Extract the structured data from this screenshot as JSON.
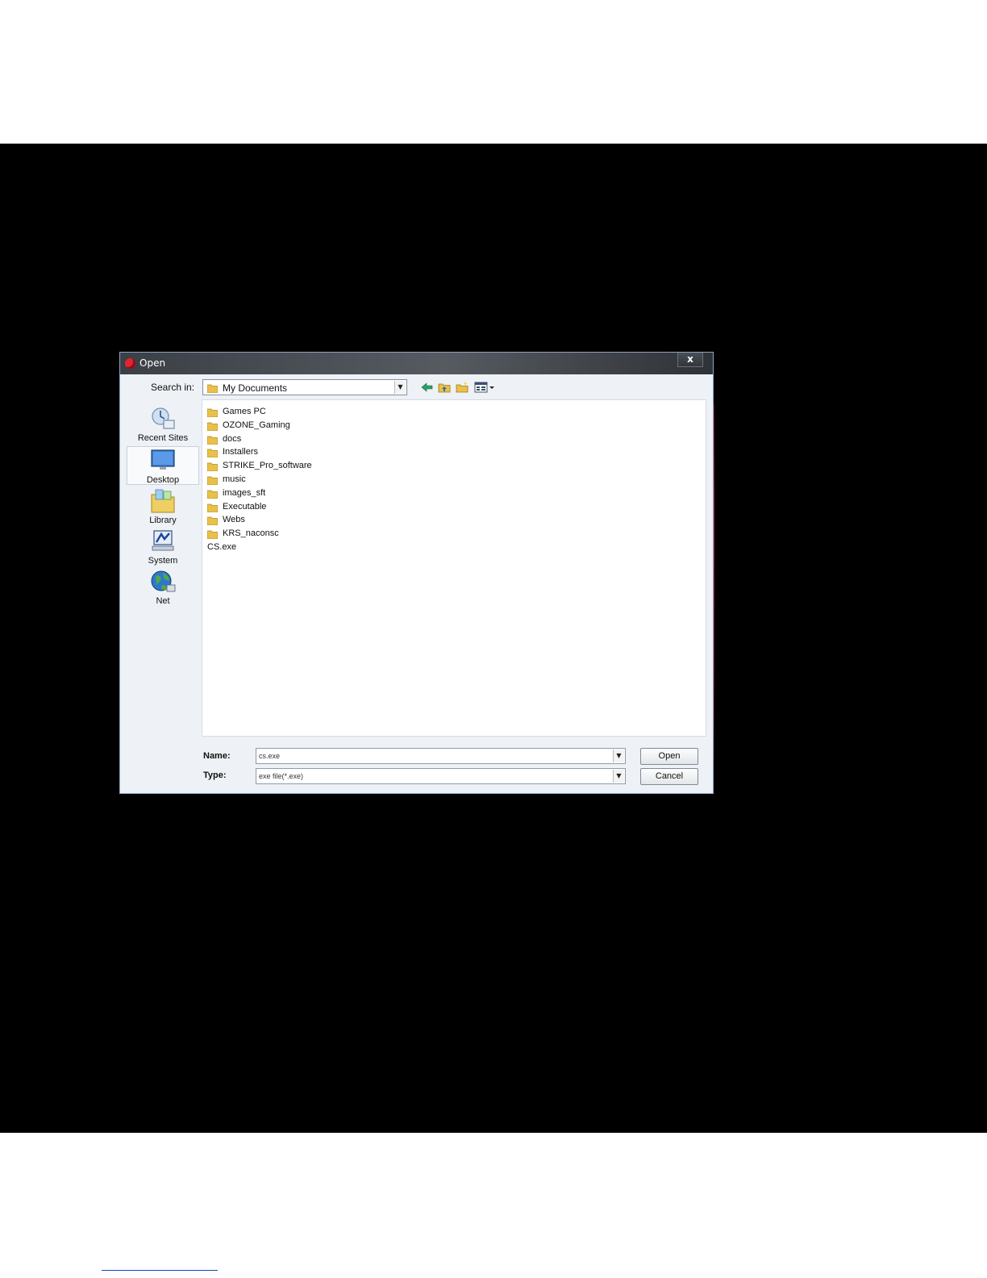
{
  "dialog": {
    "title": "Open",
    "close_label": "x",
    "search_in_label": "Search in:",
    "location": "My Documents",
    "toolbar_icons": [
      "back-arrow-icon",
      "up-folder-icon",
      "new-folder-icon",
      "view-menu-icon"
    ]
  },
  "places": [
    {
      "label": "Recent Sites",
      "icon": "recent-sites-icon"
    },
    {
      "label": "Desktop",
      "icon": "desktop-icon"
    },
    {
      "label": "Library",
      "icon": "library-icon"
    },
    {
      "label": "System",
      "icon": "system-icon"
    },
    {
      "label": "Net",
      "icon": "network-globe-icon"
    }
  ],
  "files": [
    {
      "name": "Games PC",
      "kind": "folder"
    },
    {
      "name": "OZONE_Gaming",
      "kind": "folder"
    },
    {
      "name": "docs",
      "kind": "folder"
    },
    {
      "name": "Installers",
      "kind": "folder"
    },
    {
      "name": "STRIKE_Pro_software",
      "kind": "folder"
    },
    {
      "name": "music",
      "kind": "folder"
    },
    {
      "name": "images_sft",
      "kind": "folder"
    },
    {
      "name": "Executable",
      "kind": "folder"
    },
    {
      "name": "Webs",
      "kind": "folder"
    },
    {
      "name": "KRS_naconsc",
      "kind": "folder"
    },
    {
      "name": "CS.exe",
      "kind": "file"
    }
  ],
  "footer": {
    "name_label": "Name:",
    "name_value": "cs.exe",
    "type_label": "Type:",
    "type_value": "exe file(*.exe)",
    "open_label": "Open",
    "cancel_label": "Cancel"
  },
  "colors": {
    "background": "#000000",
    "dialog_body": "#eef1f5",
    "titlebar": "#3b3f46",
    "accent_glow": "#b0213c"
  }
}
